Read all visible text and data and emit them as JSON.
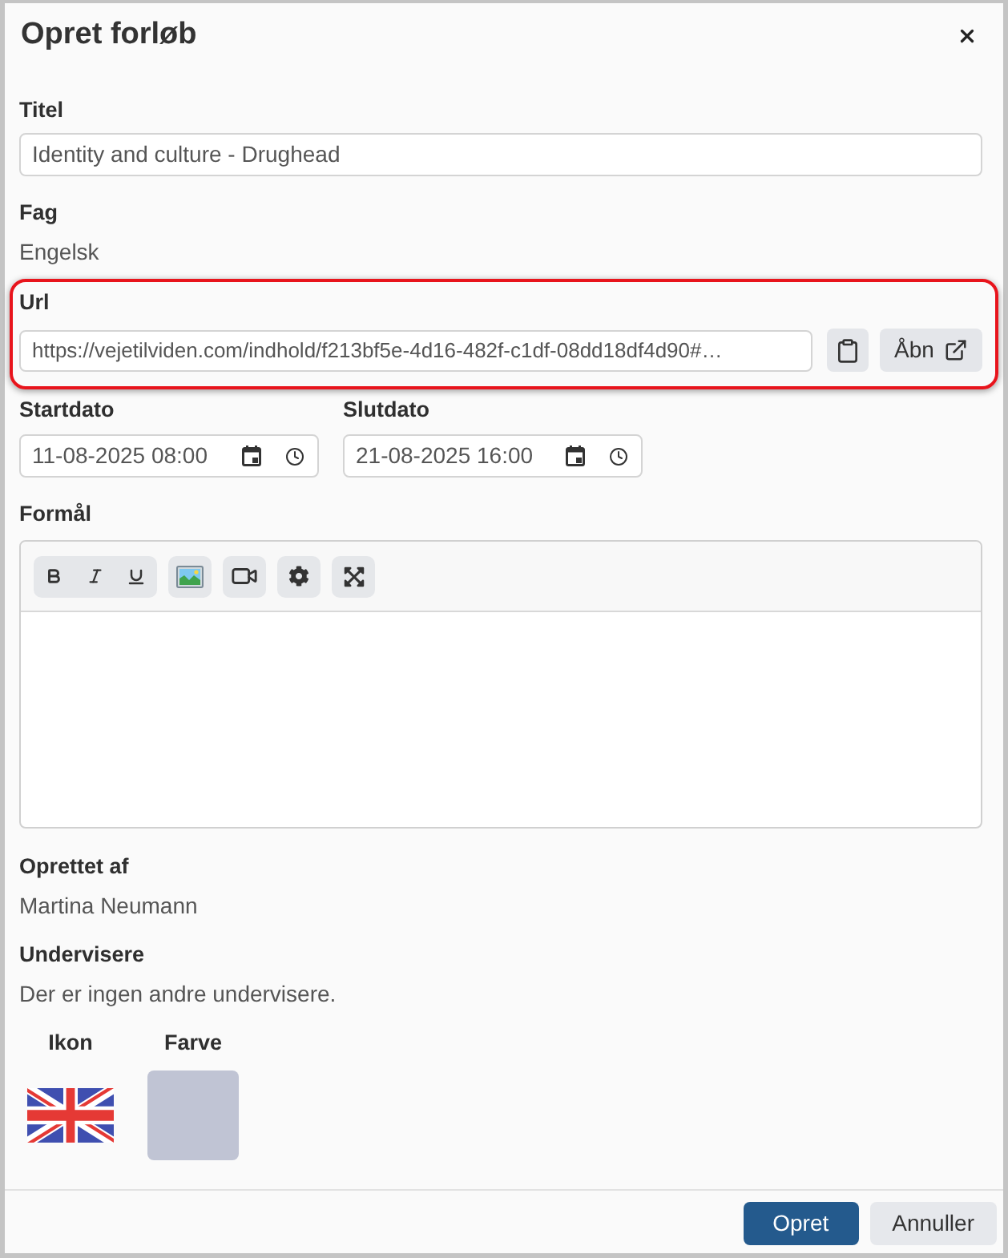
{
  "dialog": {
    "title": "Opret forløb"
  },
  "titel": {
    "label": "Titel",
    "value": "Identity and culture - Drughead"
  },
  "fag": {
    "label": "Fag",
    "value": "Engelsk"
  },
  "url": {
    "label": "Url",
    "value": "https://vejetilviden.com/indhold/f213bf5e-4d16-482f-c1df-08dd18df4d90#…",
    "highlighted": true,
    "open_button": "Åbn"
  },
  "dates": [
    {
      "label": "Startdato",
      "value": "11-08-2025 08:00"
    },
    {
      "label": "Slutdato",
      "value": "21-08-2025 16:00"
    }
  ],
  "formaal": {
    "label": "Formål"
  },
  "oprettet_af": {
    "label": "Oprettet af",
    "value": "Martina Neumann"
  },
  "undervisere": {
    "label": "Undervisere",
    "value": "Der er ingen andre undervisere."
  },
  "ikon": {
    "label": "Ikon"
  },
  "farve": {
    "label": "Farve",
    "color": "#c0c4d4"
  },
  "buttons": [
    {
      "label": "Opret",
      "kind": "primary"
    },
    {
      "label": "Annuller",
      "kind": "secondary"
    }
  ]
}
